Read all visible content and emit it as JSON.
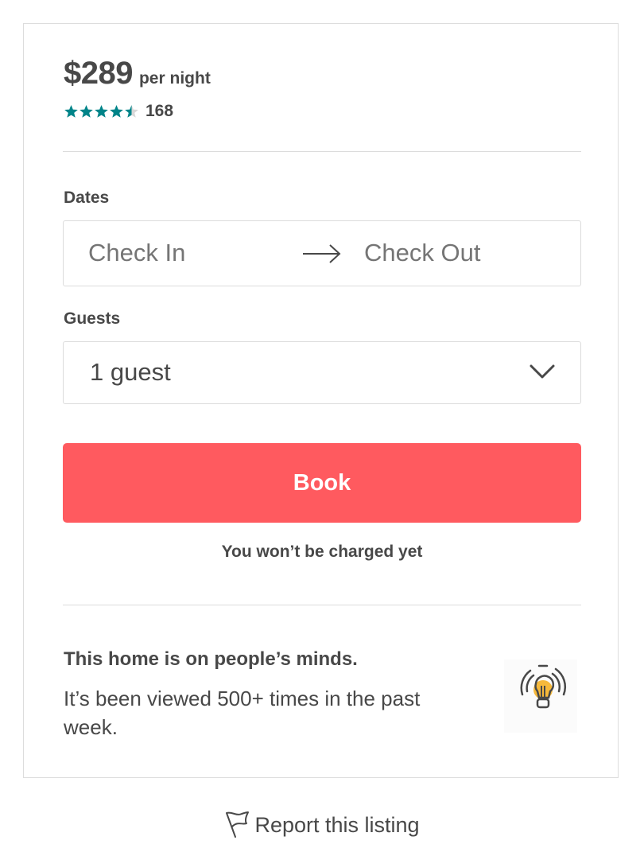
{
  "listing": {
    "price": "$289",
    "price_unit": "per night",
    "rating": 4.5,
    "review_count": "168",
    "accent_color": "#008489"
  },
  "dates": {
    "label": "Dates",
    "check_in_placeholder": "Check In",
    "check_out_placeholder": "Check Out",
    "arrow_icon": "arrow-right-icon"
  },
  "guests": {
    "label": "Guests",
    "selected": "1 guest",
    "dropdown_icon": "chevron-down-icon"
  },
  "book": {
    "label": "Book",
    "color": "#ff5a5f",
    "note": "You won’t be charged yet"
  },
  "popularity": {
    "title": "This home is on people’s minds.",
    "body": "It’s been viewed 500+ times in the past week.",
    "icon": "lightbulb-icon"
  },
  "footer": {
    "report_label": "Report this listing",
    "icon": "flag-icon"
  }
}
